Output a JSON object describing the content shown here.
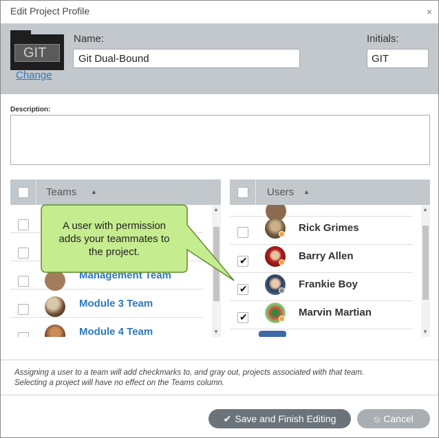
{
  "dialog": {
    "title": "Edit Project Profile",
    "close_glyph": "×"
  },
  "project": {
    "folder_text": "GIT",
    "change_label": "Change",
    "name_label": "Name:",
    "name_value": "Git Dual-Bound",
    "initials_label": "Initials:",
    "initials_value": "GIT",
    "description_label": "Description:",
    "description_value": ""
  },
  "teams": {
    "header": "Teams",
    "sort_glyph": "▲",
    "rows": [
      {
        "name": "Management Team",
        "checked": false
      },
      {
        "name": "Module 3 Team",
        "checked": false
      },
      {
        "name": "Module 4 Team",
        "checked": false
      }
    ]
  },
  "users": {
    "header": "Users",
    "sort_glyph": "▲",
    "rows": [
      {
        "name": "Rick Grimes",
        "checked": false,
        "status_color": "#f0a23a"
      },
      {
        "name": "Barry Allen",
        "checked": true,
        "status_color": "#f0a23a"
      },
      {
        "name": "Frankie Boy",
        "checked": true,
        "status_color": "#8a8a8a"
      },
      {
        "name": "Marvin Martian",
        "checked": true,
        "status_color": "#f0a23a"
      }
    ]
  },
  "callout": {
    "line1": "A user with permission",
    "line2": "adds your teammates to",
    "line3": "the project."
  },
  "footer": {
    "note_line1": "Assigning a user to a team will add checkmarks to, and gray out, projects associated with that team.",
    "note_line2": "Selecting a project will have no effect on the Teams column.",
    "save_label": "Save and Finish Editing",
    "save_icon": "✔",
    "cancel_label": "Cancel",
    "cancel_icon": "⦸"
  },
  "colors": {
    "accent": "#2a78bd",
    "header_bg": "#c3c8cd",
    "callout_fill": "#c5ec8f",
    "callout_border": "#5e8a2f"
  }
}
